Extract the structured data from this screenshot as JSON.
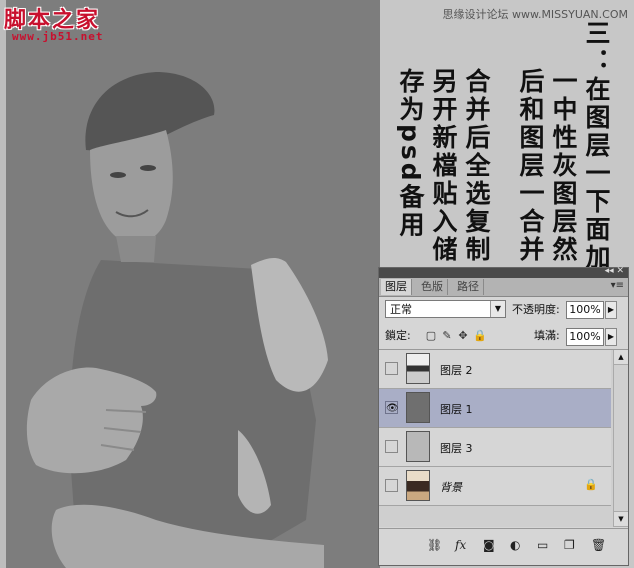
{
  "logo": {
    "text": "脚本之家",
    "url": "www.jb51.net"
  },
  "watermark": "思缘设计论坛 www.MISSYUAN.COM",
  "instructions": {
    "col1": "三：在图层一下面加",
    "col2": "一中性灰图层然",
    "col3": "后和图层一合并",
    "col4": "合并后全选复制",
    "col5": "另开新檔贴入储",
    "col6": "存为psd备用"
  },
  "panel": {
    "tabs": [
      "图层",
      "色版",
      "路径"
    ],
    "blend_mode": "正常",
    "opacity_label": "不透明度:",
    "opacity_value": "100%",
    "lock_label": "鎖定:",
    "fill_label": "填滿:",
    "fill_value": "100%",
    "layers": [
      {
        "name": "图层 2",
        "visible": false,
        "selected": false
      },
      {
        "name": "图层 1",
        "visible": true,
        "selected": true
      },
      {
        "name": "图层 3",
        "visible": false,
        "selected": false
      },
      {
        "name": "背景",
        "visible": false,
        "selected": false,
        "locked": true
      }
    ],
    "bottom_icons": [
      "link-icon",
      "fx-icon",
      "mask-icon",
      "adjustment-icon",
      "folder-icon",
      "new-layer-icon",
      "trash-icon"
    ]
  },
  "colors": {
    "canvas_gray": "#7d7d7d",
    "selected_layer": "#a9aec6",
    "logo_red": "#c8102e"
  }
}
